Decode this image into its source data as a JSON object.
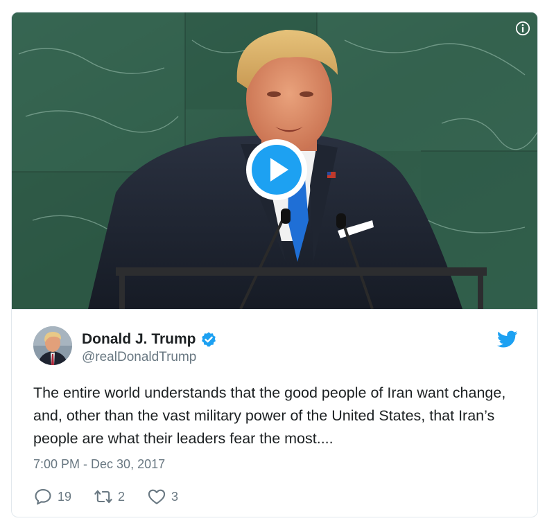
{
  "media": {
    "info_icon": "info-circle-icon",
    "play_icon": "play-circle-icon"
  },
  "author": {
    "display_name": "Donald J. Trump",
    "handle": "@realDonaldTrump",
    "verified": true,
    "verified_icon": "verified-badge-icon",
    "avatar_icon": "avatar"
  },
  "tweet": {
    "text": "The entire world understands that the good people of Iran want change, and, other than the vast military power of the United States, that Iran’s people are what their leaders fear the most....",
    "timestamp": "7:00 PM - Dec 30, 2017"
  },
  "actions": {
    "reply_count": "19",
    "retweet_count": "2",
    "like_count": "3",
    "reply_icon": "reply-bubble-icon",
    "retweet_icon": "retweet-icon",
    "like_icon": "heart-icon"
  },
  "brand": {
    "logo_icon": "twitter-bird-icon",
    "accent": "#1da1f2",
    "text_primary": "#1c2022",
    "text_secondary": "#697882",
    "border": "#e1e8ed"
  }
}
